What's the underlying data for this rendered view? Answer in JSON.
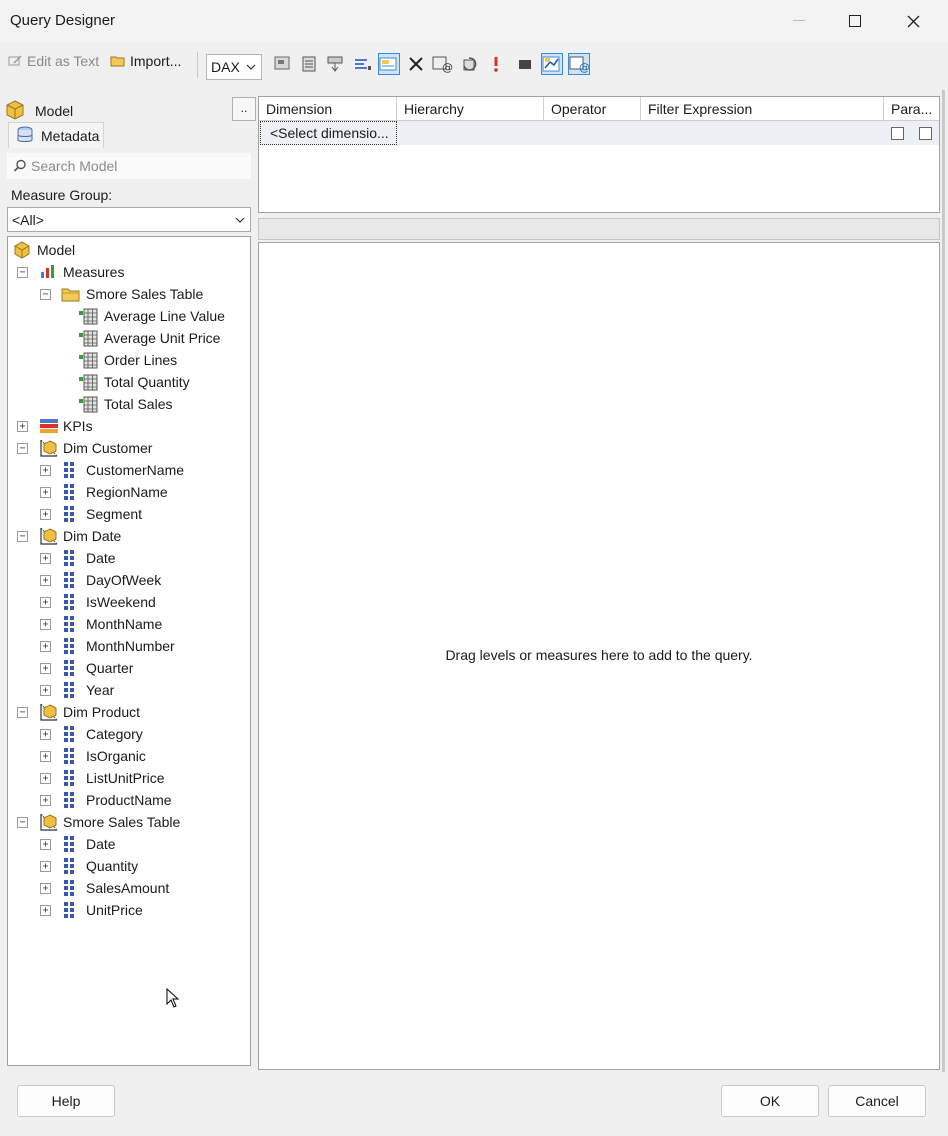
{
  "window": {
    "title": "Query Designer"
  },
  "toolbar": {
    "edit_as_text": "Edit as Text",
    "import": "Import...",
    "language": "DAX"
  },
  "left": {
    "model_label": "Model",
    "dots": "..",
    "tab_metadata": "Metadata",
    "search_placeholder": "Search Model",
    "measure_group_label": "Measure Group:",
    "measure_group_value": "<All>"
  },
  "tree": [
    {
      "label": "Model",
      "icon": "cube-icon",
      "level": 0,
      "expander": ""
    },
    {
      "label": "Measures",
      "icon": "measures-icon",
      "level": 1,
      "expander": "−"
    },
    {
      "label": "Smore Sales Table",
      "icon": "folder-icon",
      "level": 2,
      "expander": "−"
    },
    {
      "label": "Average Line Value",
      "icon": "measure-icon",
      "level": 3,
      "expander": ""
    },
    {
      "label": "Average Unit Price",
      "icon": "measure-icon",
      "level": 3,
      "expander": ""
    },
    {
      "label": "Order Lines",
      "icon": "measure-icon",
      "level": 3,
      "expander": ""
    },
    {
      "label": "Total Quantity",
      "icon": "measure-icon",
      "level": 3,
      "expander": ""
    },
    {
      "label": "Total Sales",
      "icon": "measure-icon",
      "level": 3,
      "expander": ""
    },
    {
      "label": "KPIs",
      "icon": "kpi-icon",
      "level": 1,
      "expander": "+"
    },
    {
      "label": "Dim Customer",
      "icon": "dimension-icon",
      "level": 1,
      "expander": "−"
    },
    {
      "label": "CustomerName",
      "icon": "hierarchy-icon",
      "level": 2,
      "expander": "+"
    },
    {
      "label": "RegionName",
      "icon": "hierarchy-icon",
      "level": 2,
      "expander": "+"
    },
    {
      "label": "Segment",
      "icon": "hierarchy-icon",
      "level": 2,
      "expander": "+"
    },
    {
      "label": "Dim Date",
      "icon": "dimension-icon",
      "level": 1,
      "expander": "−"
    },
    {
      "label": "Date",
      "icon": "hierarchy-icon",
      "level": 2,
      "expander": "+"
    },
    {
      "label": "DayOfWeek",
      "icon": "hierarchy-icon",
      "level": 2,
      "expander": "+"
    },
    {
      "label": "IsWeekend",
      "icon": "hierarchy-icon",
      "level": 2,
      "expander": "+"
    },
    {
      "label": "MonthName",
      "icon": "hierarchy-icon",
      "level": 2,
      "expander": "+"
    },
    {
      "label": "MonthNumber",
      "icon": "hierarchy-icon",
      "level": 2,
      "expander": "+"
    },
    {
      "label": "Quarter",
      "icon": "hierarchy-icon",
      "level": 2,
      "expander": "+"
    },
    {
      "label": "Year",
      "icon": "hierarchy-icon",
      "level": 2,
      "expander": "+"
    },
    {
      "label": "Dim Product",
      "icon": "dimension-icon",
      "level": 1,
      "expander": "−"
    },
    {
      "label": "Category",
      "icon": "hierarchy-icon",
      "level": 2,
      "expander": "+"
    },
    {
      "label": "IsOrganic",
      "icon": "hierarchy-icon",
      "level": 2,
      "expander": "+"
    },
    {
      "label": "ListUnitPrice",
      "icon": "hierarchy-icon",
      "level": 2,
      "expander": "+"
    },
    {
      "label": "ProductName",
      "icon": "hierarchy-icon",
      "level": 2,
      "expander": "+"
    },
    {
      "label": "Smore Sales Table",
      "icon": "dimension-icon",
      "level": 1,
      "expander": "−"
    },
    {
      "label": "Date",
      "icon": "hierarchy-icon",
      "level": 2,
      "expander": "+"
    },
    {
      "label": "Quantity",
      "icon": "hierarchy-icon",
      "level": 2,
      "expander": "+"
    },
    {
      "label": "SalesAmount",
      "icon": "hierarchy-icon",
      "level": 2,
      "expander": "+"
    },
    {
      "label": "UnitPrice",
      "icon": "hierarchy-icon",
      "level": 2,
      "expander": "+"
    }
  ],
  "filter_grid": {
    "headers": [
      "Dimension",
      "Hierarchy",
      "Operator",
      "Filter Expression",
      "Para..."
    ],
    "row": {
      "dimension": "<Select dimensio..."
    }
  },
  "results": {
    "drag_message": "Drag levels or measures here to add to the query."
  },
  "footer": {
    "help": "Help",
    "ok": "OK",
    "cancel": "Cancel"
  },
  "colors": {
    "accent": "#3d8bd4",
    "selection": "#cce4f7",
    "grid_row": "#edf0f4"
  }
}
